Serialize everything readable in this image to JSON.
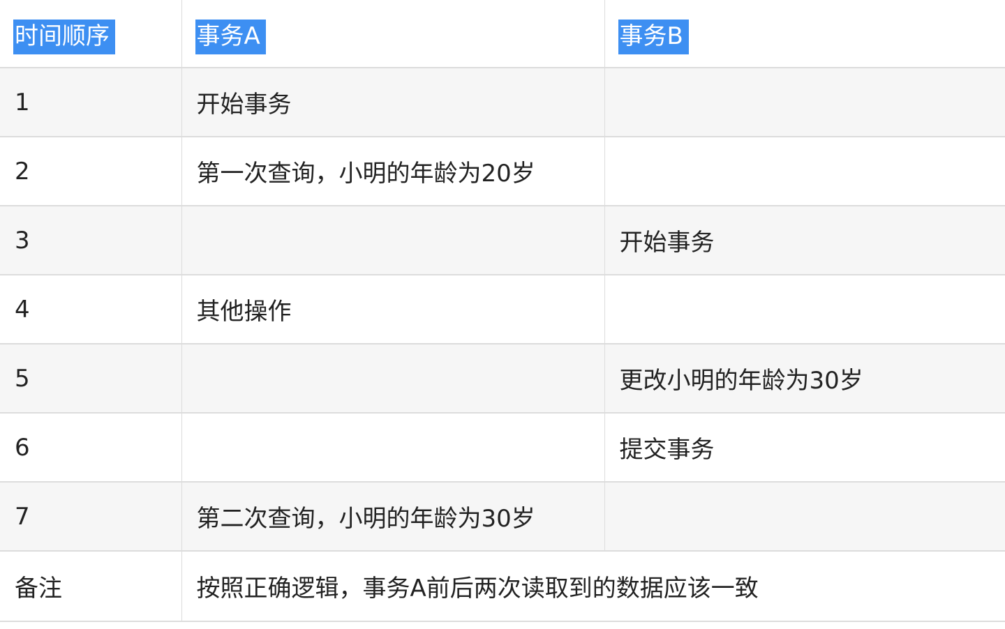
{
  "table": {
    "headers": [
      "时间顺序",
      "事务A",
      "事务B"
    ],
    "rows": [
      [
        "1",
        "开始事务",
        ""
      ],
      [
        "2",
        "第一次查询，小明的年龄为20岁",
        ""
      ],
      [
        "3",
        "",
        "开始事务"
      ],
      [
        "4",
        "其他操作",
        ""
      ],
      [
        "5",
        "",
        "更改小明的年龄为30岁"
      ],
      [
        "6",
        "",
        "提交事务"
      ],
      [
        "7",
        "第二次查询，小明的年龄为30岁",
        ""
      ]
    ],
    "note": {
      "label": "备注",
      "text": "按照正确逻辑，事务A前后两次读取到的数据应该一致"
    }
  },
  "selection_highlight_color": "#3d8ff2",
  "row_shade_color": "#f6f6f6",
  "border_color": "#dcdcdc"
}
